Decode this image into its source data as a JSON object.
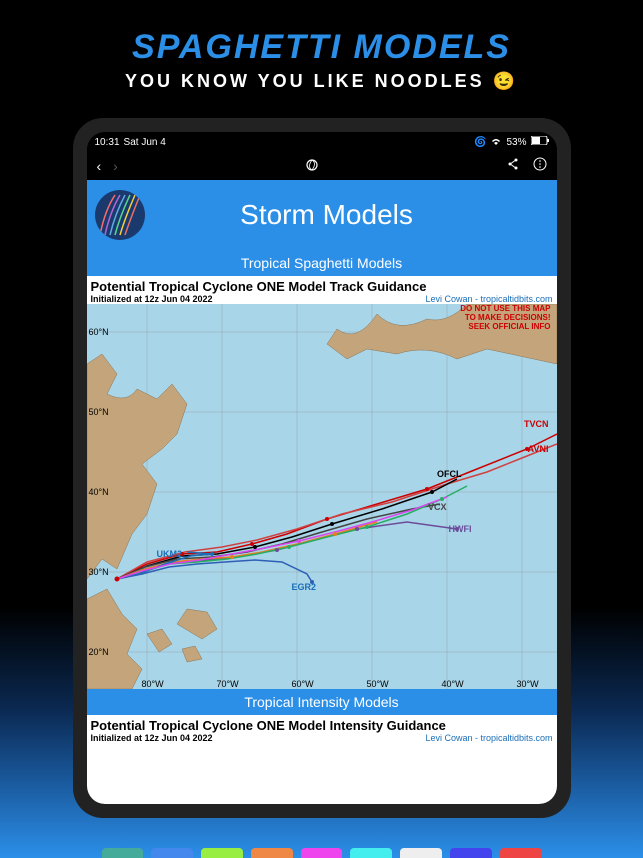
{
  "promo": {
    "title": "SPAGHETTI MODELS",
    "subtitle": "YOU KNOW YOU LIKE NOODLES 😉"
  },
  "statusBar": {
    "time": "10:31",
    "date": "Sat Jun 4",
    "battery": "53%"
  },
  "app": {
    "header": {
      "title": "Storm Models"
    },
    "sections": {
      "spaghetti": {
        "header": "Tropical Spaghetti Models",
        "mapTitle": "Potential Tropical Cyclone ONE Model Track Guidance",
        "initialized": "Initialized at 12z Jun 04 2022",
        "attribution": "Levi Cowan - tropicaltidbits.com",
        "warning1": "DO NOT USE THIS MAP",
        "warning2": "TO MAKE DECISIONS!",
        "warning3": "SEEK OFFICIAL INFO",
        "latLabels": [
          "60°N",
          "50°N",
          "40°N",
          "30°N",
          "20°N"
        ],
        "lonLabels": [
          "80°W",
          "70°W",
          "60°W",
          "50°W",
          "40°W",
          "30°W"
        ],
        "models": [
          {
            "name": "TVCN",
            "color": "#cc0000"
          },
          {
            "name": "AVNI",
            "color": "#cc0000"
          },
          {
            "name": "OFCL",
            "color": "#000000"
          },
          {
            "name": "VCX",
            "color": "#444444"
          },
          {
            "name": "HWFI",
            "color": "#6B4C9A"
          },
          {
            "name": "UKM2",
            "color": "#1a6eb8"
          },
          {
            "name": "EGR2",
            "color": "#1a6eb8"
          }
        ]
      },
      "intensity": {
        "header": "Tropical Intensity Models",
        "mapTitle": "Potential Tropical Cyclone ONE Model Intensity Guidance",
        "initialized": "Initialized at 12z Jun 04 2022",
        "attribution": "Levi Cowan - tropicaltidbits.com"
      }
    }
  }
}
